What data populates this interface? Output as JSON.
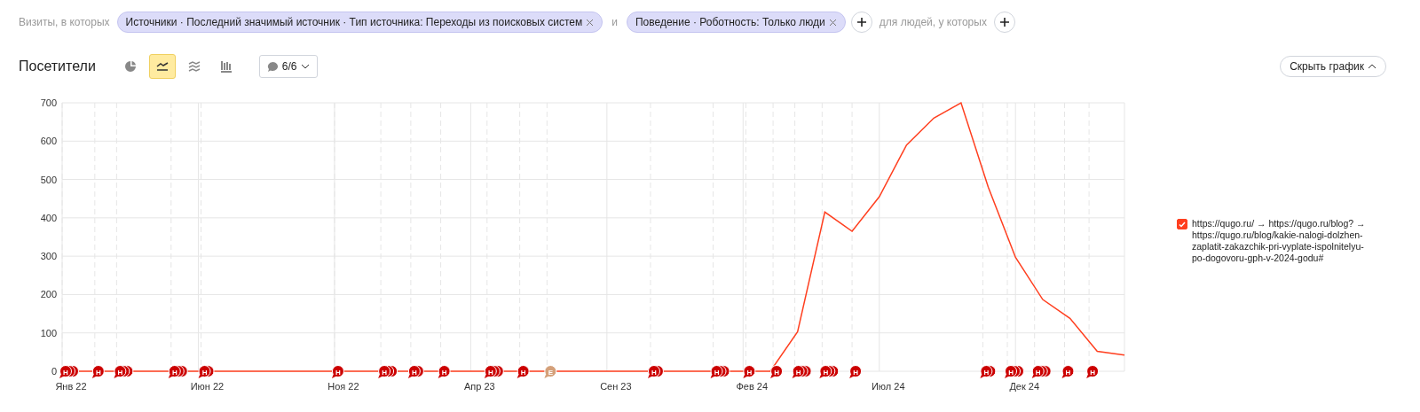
{
  "filter": {
    "prefix": "Визиты, в которых",
    "conditions": [
      {
        "text": "Источники · Последний значимый источник · Тип источника: Переходы из поисковых систем"
      },
      {
        "text": "Поведение · Роботность: Только люди"
      }
    ],
    "joiner": "и",
    "people_label": "для людей, у которых"
  },
  "report": {
    "title": "Посетители",
    "view_modes": [
      {
        "kind": "pie",
        "selected": false
      },
      {
        "kind": "line",
        "selected": true
      },
      {
        "kind": "area",
        "selected": false
      },
      {
        "kind": "bars",
        "selected": false
      }
    ],
    "comments": {
      "label": "6/6"
    },
    "hide_button": "Скрыть график"
  },
  "chart": {
    "chart_data": {
      "type": "line",
      "categories": [
        "Янв 22",
        null,
        null,
        null,
        null,
        "Июн 22",
        null,
        null,
        null,
        null,
        "Ноя 22",
        null,
        null,
        null,
        null,
        "Апр 23",
        null,
        null,
        null,
        null,
        "Сен 23",
        null,
        null,
        null,
        null,
        "Фев 24",
        null,
        null,
        null,
        null,
        "Июл 24",
        null,
        null,
        null,
        null,
        "Дек 24",
        null,
        null,
        null,
        null
      ],
      "ylim": [
        0,
        700
      ],
      "yticks": [
        0,
        100,
        200,
        300,
        400,
        500,
        600,
        700
      ],
      "series": [
        {
          "name": "https://qugo.ru/ → https://qugo.ru/blog? → https://qugo.ru/blog/kakie-nalogi-dolzhen-zaplatit-zakazchik-pri-vyplate-ispolnitelyu-po-dogovoru-gph-v-2024-godu#",
          "color": "#ff3f1f",
          "values": [
            0,
            0,
            0,
            0,
            0,
            0,
            0,
            0,
            0,
            0,
            0,
            0,
            0,
            0,
            0,
            0,
            0,
            0,
            0,
            0,
            0,
            0,
            0,
            0,
            0,
            0,
            0,
            103,
            415,
            365,
            455,
            590,
            660,
            700,
            480,
            297,
            187,
            138,
            52,
            42
          ]
        }
      ],
      "grid": true
    },
    "comment_markers": [
      {
        "text": "Н",
        "kind": "triple",
        "color": "#cc0000"
      },
      {
        "text": "Н",
        "kind": "single",
        "color": "#cc0000"
      },
      {
        "text": "Н",
        "kind": "triple",
        "color": "#cc0000"
      },
      {
        "text": "Н",
        "kind": "triple",
        "color": "#cc0000"
      },
      {
        "text": "Н",
        "kind": "double",
        "color": "#cc0000"
      },
      {
        "text": "Н",
        "kind": "single",
        "color": "#cc0000"
      },
      {
        "text": "Н",
        "kind": "triple",
        "color": "#cc0000"
      },
      {
        "text": "Н",
        "kind": "double",
        "color": "#cc0000"
      },
      {
        "text": "Н",
        "kind": "single",
        "color": "#cc0000"
      },
      {
        "text": "Н",
        "kind": "triple",
        "color": "#cc0000"
      },
      {
        "text": "Н",
        "kind": "single",
        "color": "#cc0000"
      },
      {
        "text": "Е",
        "kind": "single",
        "color": "#d4a07a"
      },
      {
        "text": "Н",
        "kind": "double",
        "color": "#cc0000"
      },
      {
        "text": "Н",
        "kind": "triple",
        "color": "#cc0000"
      },
      {
        "text": "Н",
        "kind": "single",
        "color": "#cc0000"
      },
      {
        "text": "Н",
        "kind": "single",
        "color": "#cc0000"
      },
      {
        "text": "Н",
        "kind": "triple",
        "color": "#cc0000"
      },
      {
        "text": "Н",
        "kind": "triple",
        "color": "#cc0000"
      },
      {
        "text": "Н",
        "kind": "single",
        "color": "#cc0000"
      },
      {
        "text": "Н",
        "kind": "double",
        "color": "#cc0000"
      },
      {
        "text": "Н",
        "kind": "triple",
        "color": "#cc0000"
      },
      {
        "text": "Н",
        "kind": "triple",
        "color": "#cc0000"
      },
      {
        "text": "Н",
        "kind": "single",
        "color": "#cc0000"
      },
      {
        "text": "Н",
        "kind": "single",
        "color": "#cc0000"
      }
    ],
    "legend": [
      {
        "checked": true
      }
    ]
  }
}
